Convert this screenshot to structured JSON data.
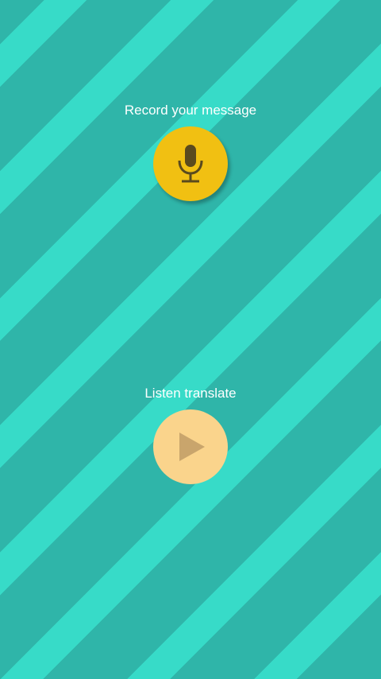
{
  "record": {
    "label": "Record your message",
    "button_icon": "microphone-icon",
    "button_color": "#f1c012",
    "icon_color": "#5a4a1e"
  },
  "listen": {
    "label": "Listen translate",
    "button_icon": "play-icon",
    "button_color": "#fad48c",
    "icon_color": "#c9a56c"
  },
  "background": {
    "stripe_dark": "#2fb5a9",
    "stripe_light": "#37dbc8"
  }
}
